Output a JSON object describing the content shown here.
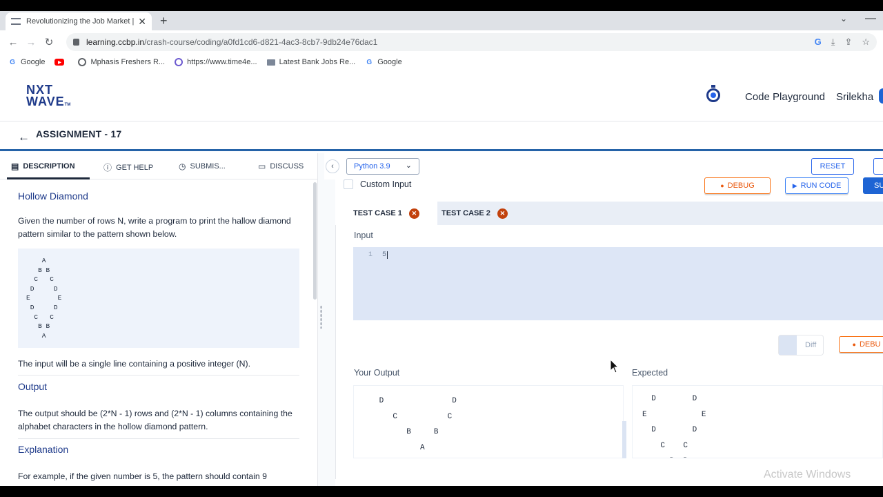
{
  "browser": {
    "tab_title": "Revolutionizing the Job Market |",
    "new_tab_glyph": "+",
    "url_host": "learning.ccbp.in",
    "url_path": "/crash-course/coding/a0fd1cd6-d821-4ac3-8cb7-9db24e76dac1",
    "bookmarks": [
      {
        "label": "Google",
        "icon": "google-icon"
      },
      {
        "label": "",
        "icon": "youtube-icon"
      },
      {
        "label": "Mphasis Freshers R...",
        "icon": "globe-icon"
      },
      {
        "label": "https://www.time4e...",
        "icon": "site-icon"
      },
      {
        "label": "Latest Bank Jobs Re...",
        "icon": "bank-icon"
      },
      {
        "label": "Google",
        "icon": "google-icon"
      }
    ]
  },
  "header": {
    "logo_line1": "NXT",
    "logo_line2": "WAVE",
    "logo_tm": "TM",
    "code_playground": "Code Playground",
    "user_name": "Srilekha"
  },
  "assignment": {
    "back_glyph": "←",
    "title": "ASSIGNMENT - 17"
  },
  "left_tabs": [
    {
      "label": "DESCRIPTION",
      "icon": "description-icon",
      "active": true
    },
    {
      "label": "GET HELP",
      "icon": "help-icon",
      "active": false
    },
    {
      "label": "SUBMIS...",
      "icon": "clock-icon",
      "active": false
    },
    {
      "label": "DISCUSS",
      "icon": "chat-icon",
      "active": false
    }
  ],
  "description": {
    "title": "Hollow Diamond",
    "intro": "Given the number of rows N, write a program to print the hallow diamond pattern similar to the pattern shown below.",
    "pattern": "    A\n   B B\n  C   C\n D     D\nE       E\n D     D\n  C   C\n   B B\n    A",
    "input_text": "The input will be a single line containing a positive integer (N).",
    "output_heading": "Output",
    "output_text": "The output should be (2*N - 1) rows and (2*N - 1) columns containing the alphabet characters in the hollow diamond pattern.",
    "explanation_heading": "Explanation",
    "explanation_text": "For example, if the given number is 5, the pattern should contain 9"
  },
  "editor_toolbar": {
    "collapse_glyph": "‹",
    "language": "Python 3.9",
    "reset": "RESET"
  },
  "run_controls": {
    "custom_input": "Custom Input",
    "debug": "DEBUG",
    "run_code": "RUN CODE",
    "submit": "SU"
  },
  "test_cases": [
    {
      "label": "TEST CASE 1",
      "status": "failed",
      "active": true
    },
    {
      "label": "TEST CASE 2",
      "status": "failed",
      "active": false
    }
  ],
  "test_panel": {
    "input_label": "Input",
    "line_number": "1",
    "input_value": "5",
    "diff_label": "Diff",
    "debug_label": "DEBU",
    "your_output_label": "Your Output",
    "expected_label": "Expected",
    "your_output": " D               D\n\n    C           C\n\n       B     B\n\n          A",
    "expected_output": "  D        D\nE            E\n  D        D\n    C    C\n      B  B"
  },
  "os": {
    "watermark": "Activate Windows"
  },
  "colors": {
    "primary": "#2563eb",
    "debug_orange": "#ea580c",
    "fail_red": "#c2410c",
    "brand_navy": "#1e3a8a"
  }
}
